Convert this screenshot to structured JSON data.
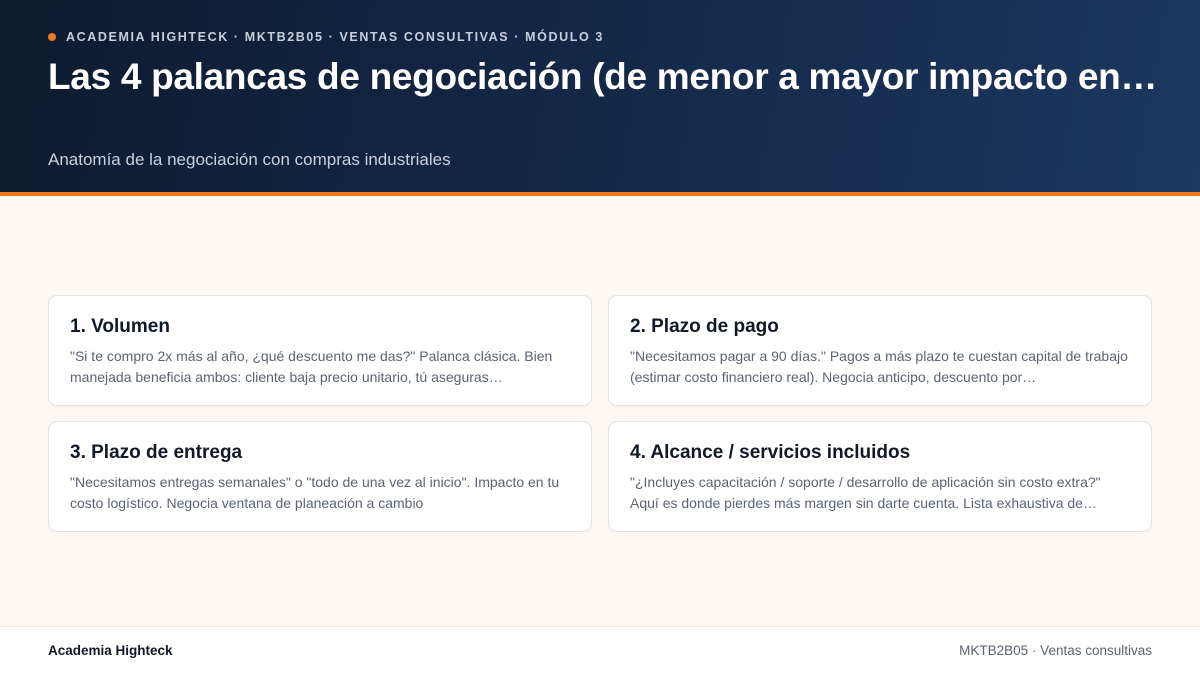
{
  "header": {
    "eyebrow": "ACADEMIA HIGHTECK · MKTB2B05 · VENTAS CONSULTIVAS · MÓDULO 3",
    "title": "Las 4 palancas de negociación (de menor a mayor impacto en…",
    "subtitle": "Anatomía de la negociación con compras industriales"
  },
  "cards": [
    {
      "title": "1. Volumen",
      "body": "\"Si te compro 2x más al año, ¿qué descuento me das?\" Palanca clásica. Bien manejada beneficia ambos: cliente baja precio unitario, tú aseguras…"
    },
    {
      "title": "2. Plazo de pago",
      "body": "\"Necesitamos pagar a 90 días.\" Pagos a más plazo te cuestan capital de trabajo (estimar costo financiero real). Negocia anticipo, descuento por…"
    },
    {
      "title": "3. Plazo de entrega",
      "body": "\"Necesitamos entregas semanales\" o \"todo de una vez al inicio\". Impacto en tu costo logístico. Negocia ventana de planeación a cambio"
    },
    {
      "title": "4. Alcance / servicios incluidos",
      "body": "\"¿Incluyes capacitación / soporte / desarrollo de aplicación sin costo extra?\" Aquí es donde pierdes más margen sin darte cuenta. Lista exhaustiva de…"
    }
  ],
  "footer": {
    "brand": "Academia Highteck",
    "course": "MKTB2B05 · Ventas consultivas"
  },
  "colors": {
    "accent": "#f07c22",
    "header_bg": "#0d1b2e",
    "page_bg": "#fdf8f3"
  }
}
